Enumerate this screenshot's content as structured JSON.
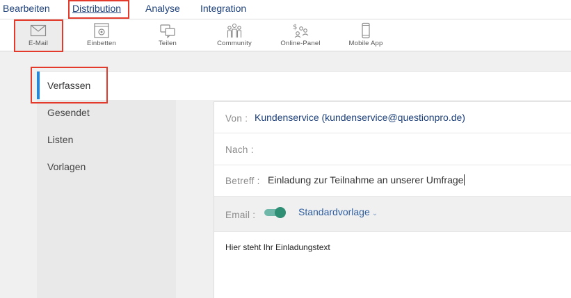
{
  "topnav": {
    "items": [
      "Bearbeiten",
      "Distribution",
      "Analyse",
      "Integration"
    ],
    "active": "Distribution"
  },
  "subnav": {
    "items": [
      {
        "label": "E-Mail",
        "icon": "envelope-icon"
      },
      {
        "label": "Einbetten",
        "icon": "embed-gear-icon"
      },
      {
        "label": "Teilen",
        "icon": "share-chat-icon"
      },
      {
        "label": "Community",
        "icon": "community-people-icon"
      },
      {
        "label": "Online-Panel",
        "icon": "panel-people-money-icon"
      },
      {
        "label": "Mobile App",
        "icon": "mobile-phone-icon"
      }
    ],
    "selected": "E-Mail"
  },
  "sidebar": {
    "items": [
      "Verfassen",
      "Gesendet",
      "Listen",
      "Vorlagen"
    ],
    "active": "Verfassen"
  },
  "compose": {
    "from_label": "Von :",
    "from_value": "Kundenservice (kundenservice@questionpro.de)",
    "to_label": "Nach :",
    "to_value": "",
    "subject_label": "Betreff :",
    "subject_value": "Einladung zur Teilnahme an unserer Umfrage",
    "email_label": "Email :",
    "email_toggle_on": true,
    "template_label": "Standardvorlage",
    "body_text": "Hier steht Ihr Einladungstext"
  },
  "colors": {
    "nav_text": "#1c3f7a",
    "highlight_box": "#e43a2c",
    "accent": "#1e88e5",
    "toggle": "#2e8f74"
  }
}
